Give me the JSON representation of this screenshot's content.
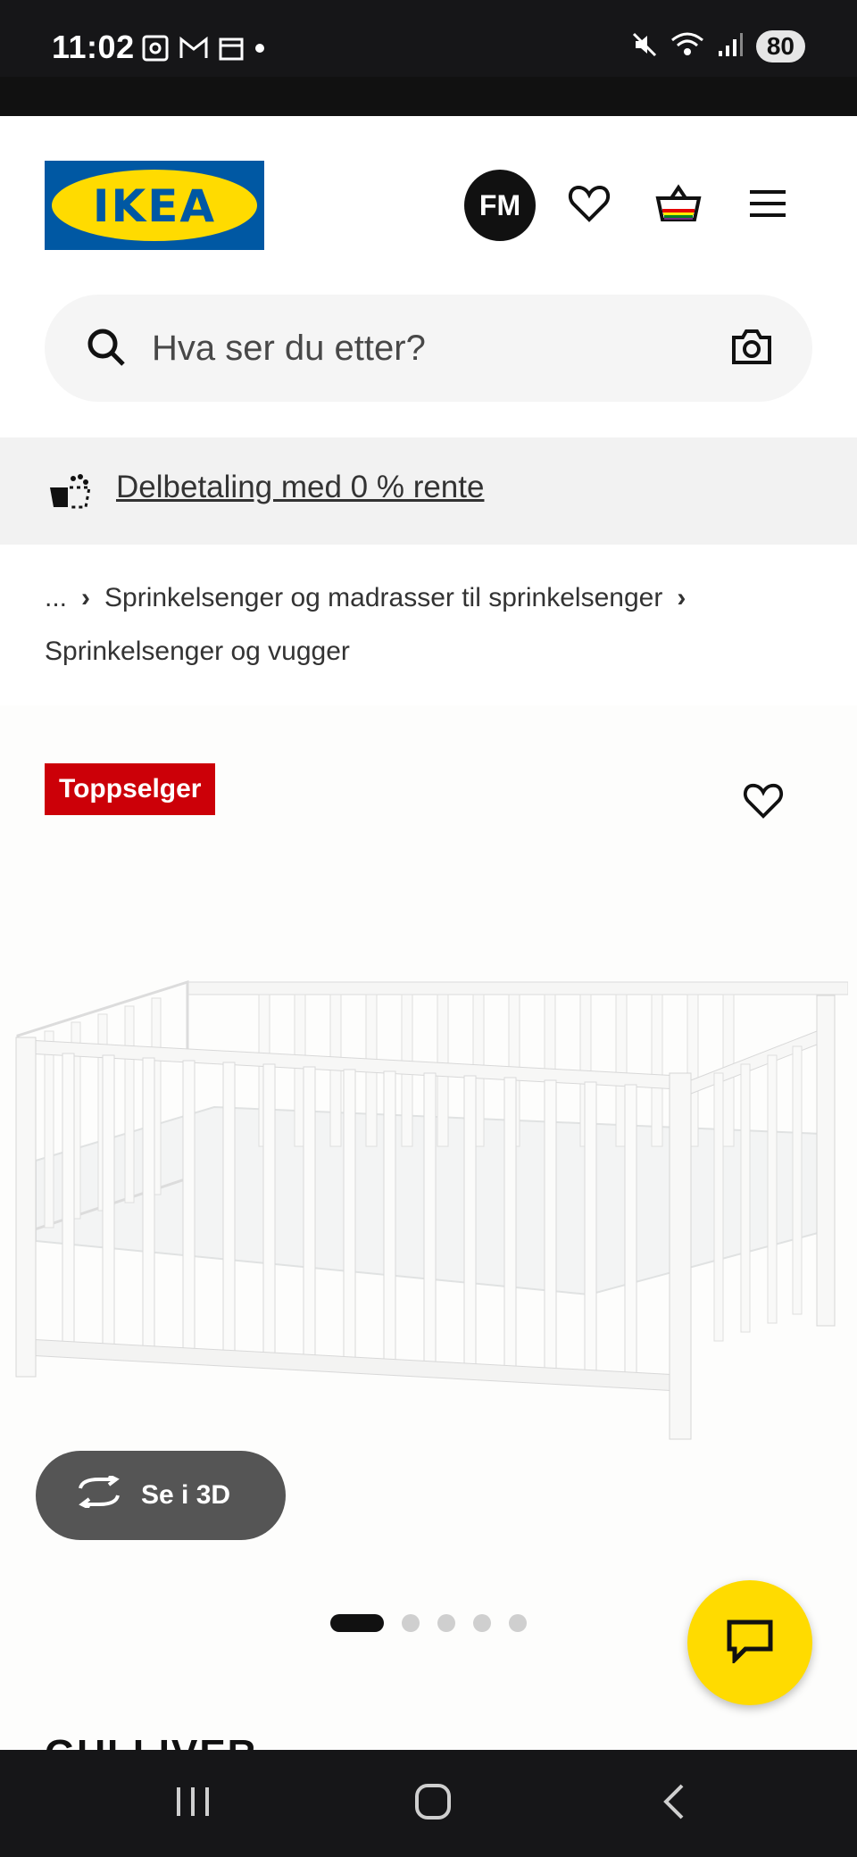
{
  "status_bar": {
    "time": "11:02",
    "battery": "80",
    "icons": [
      "screenshot-icon",
      "gmail-icon",
      "calendar-icon",
      "dot-icon",
      "mute-icon",
      "wifi-icon",
      "signal-icon"
    ]
  },
  "header": {
    "logo": "IKEA",
    "avatar_initials": "FM",
    "icons": [
      "heart-icon",
      "basket-icon",
      "menu-icon"
    ]
  },
  "search": {
    "placeholder": "Hva ser du etter?"
  },
  "promo": {
    "link_text": "Delbetaling med 0 % rente"
  },
  "breadcrumb": {
    "ellipsis": "...",
    "level1": "Sprinkelsenger og madrasser til sprinkelsenger",
    "level2": "Sprinkelsenger og vugger"
  },
  "product": {
    "badge": "Toppselger",
    "see_3d_label": "Se i 3D",
    "carousel": {
      "total": 5,
      "active": 1
    },
    "title_peek": "GULLIVER"
  },
  "colors": {
    "ikea_blue": "#0058a3",
    "ikea_yellow": "#ffdb00",
    "badge_red": "#cc0008",
    "chat_yellow": "#ffdb00"
  }
}
